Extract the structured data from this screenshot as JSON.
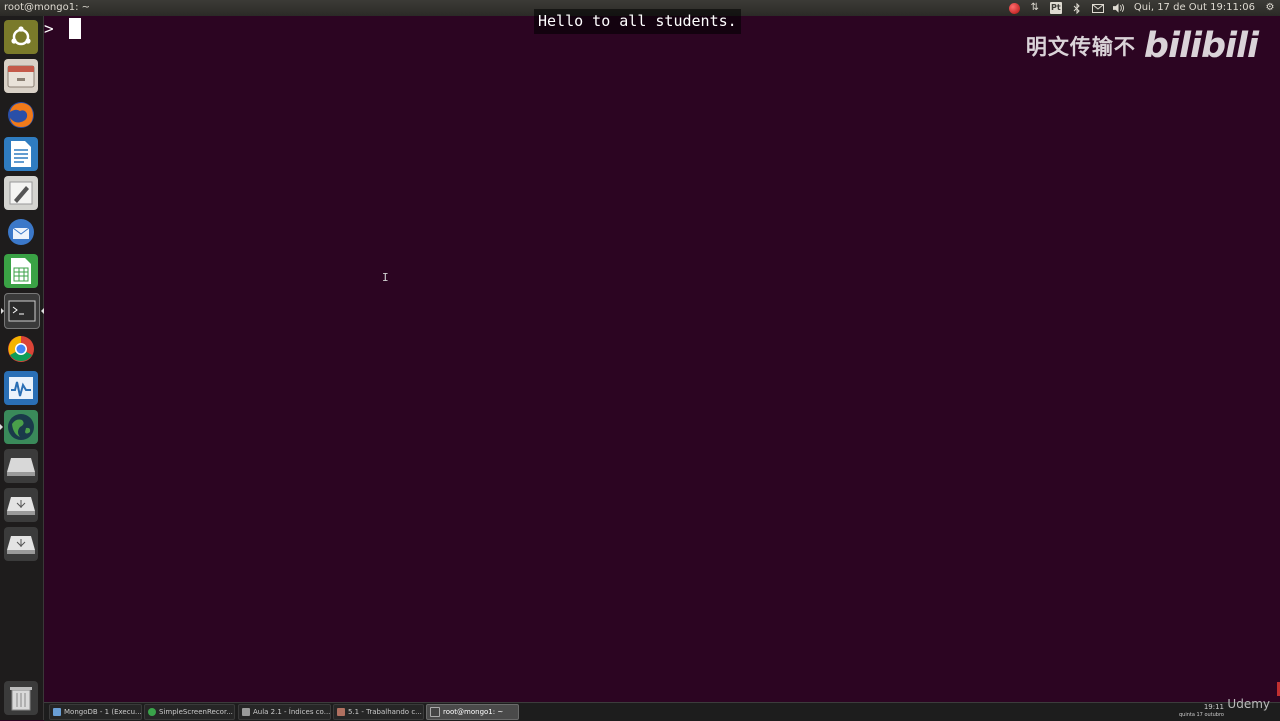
{
  "top_panel": {
    "window_title": "root@mongo1: ~",
    "tray_icons": [
      "record-icon",
      "network-arrows-icon",
      "keyboard-layout-icon",
      "bluetooth-icon",
      "mail-icon",
      "volume-icon",
      "settings-gear-icon"
    ],
    "keyboard_layout": "Pt",
    "clock": "Qui, 17 de Out 19:11:06"
  },
  "launcher": {
    "items": [
      {
        "name": "ubuntu-dash",
        "icon": "ubuntu-logo-icon"
      },
      {
        "name": "files",
        "icon": "file-cabinet-icon"
      },
      {
        "name": "firefox",
        "icon": "firefox-icon"
      },
      {
        "name": "writer",
        "icon": "document-icon"
      },
      {
        "name": "text-editor",
        "icon": "text-editor-icon"
      },
      {
        "name": "thunderbird",
        "icon": "mail-client-icon"
      },
      {
        "name": "calc",
        "icon": "spreadsheet-icon"
      },
      {
        "name": "terminal",
        "icon": "terminal-icon"
      },
      {
        "name": "chrome",
        "icon": "chrome-icon"
      },
      {
        "name": "system-monitor",
        "icon": "monitor-chart-icon"
      },
      {
        "name": "globe-app",
        "icon": "globe-icon"
      },
      {
        "name": "drive-1",
        "icon": "drive-icon"
      },
      {
        "name": "usb-drive-1",
        "icon": "usb-drive-icon"
      },
      {
        "name": "usb-drive-2",
        "icon": "usb-drive-icon"
      },
      {
        "name": "trash",
        "icon": "trash-icon"
      }
    ]
  },
  "terminal": {
    "prompt": ">",
    "subtitle": "Hello to all students."
  },
  "watermark": {
    "text": "明文传输不",
    "logo": "bilibili"
  },
  "taskbar": {
    "tasks": [
      {
        "label": "MongoDB - 1 (Execu...",
        "active": false,
        "color": "#6a9fd6"
      },
      {
        "label": "SimpleScreenRecor...",
        "active": false,
        "color": "#3aa34a"
      },
      {
        "label": "Aula 2.1 - Índices co...",
        "active": false,
        "color": "#9a9a9a"
      },
      {
        "label": "5.1 - Trabalhando c...",
        "active": false,
        "color": "#b07060"
      },
      {
        "label": "root@mongo1: ~",
        "active": true,
        "color": "#444444"
      }
    ],
    "time": "19:11",
    "date": "quinta 17 outubro",
    "brand": "Udemy"
  }
}
